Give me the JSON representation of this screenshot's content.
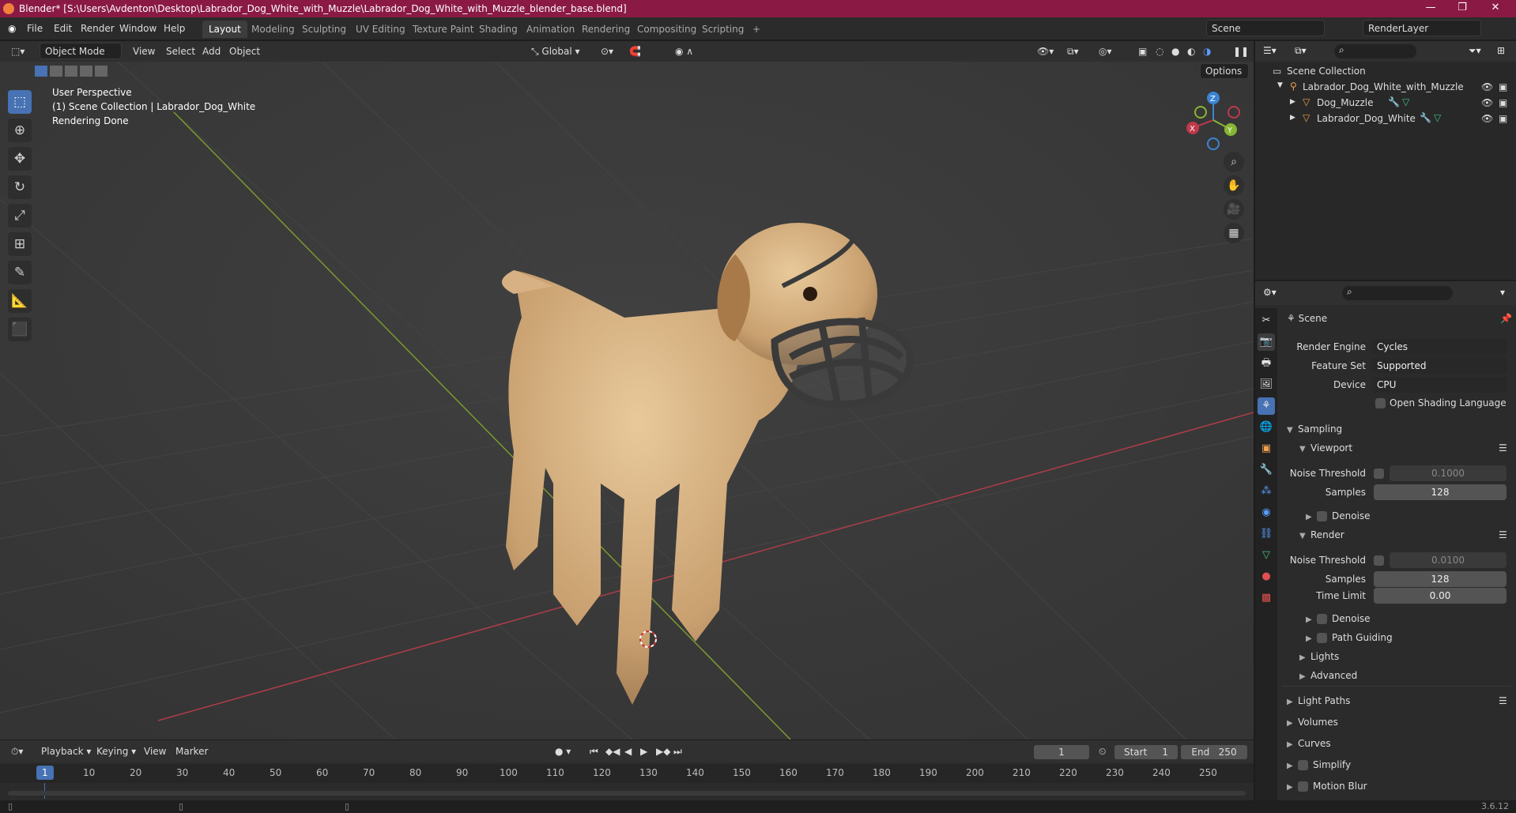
{
  "titlebar": {
    "title": "Blender* [S:\\Users\\Avdenton\\Desktop\\Labrador_Dog_White_with_Muzzle\\Labrador_Dog_White_with_Muzzle_blender_base.blend]",
    "minimize": "—",
    "restore": "❐",
    "close": "✕"
  },
  "menu": {
    "file": "File",
    "edit": "Edit",
    "render": "Render",
    "window": "Window",
    "help": "Help"
  },
  "workspaces": [
    "Layout",
    "Modeling",
    "Sculpting",
    "UV Editing",
    "Texture Paint",
    "Shading",
    "Animation",
    "Rendering",
    "Compositing",
    "Scripting",
    "+"
  ],
  "scene": {
    "name": "Scene",
    "render_layer": "RenderLayer"
  },
  "viewport_header": {
    "mode": "Object Mode",
    "view": "View",
    "select": "Select",
    "add": "Add",
    "object": "Object",
    "transform": "Global",
    "options": "Options"
  },
  "viewport": {
    "line1": "User Perspective",
    "line2": "(1) Scene Collection | Labrador_Dog_White",
    "line3": "Rendering Done"
  },
  "gizmo": {
    "z": "Z",
    "x": "X",
    "y": "Y"
  },
  "outliner": {
    "root": "Scene Collection",
    "collection": "Labrador_Dog_White_with_Muzzle",
    "obj1": "Dog_Muzzle",
    "obj2": "Labrador_Dog_White"
  },
  "properties": {
    "header": "Scene",
    "render_engine_label": "Render Engine",
    "render_engine": "Cycles",
    "feature_set_label": "Feature Set",
    "feature_set": "Supported",
    "device_label": "Device",
    "device": "CPU",
    "osl": "Open Shading Language",
    "sampling": "Sampling",
    "viewport": "Viewport",
    "noise_threshold_label": "Noise Threshold",
    "vp_noise": "0.1000",
    "samples_label": "Samples",
    "vp_samples": "128",
    "denoise": "Denoise",
    "render": "Render",
    "r_noise": "0.0100",
    "r_samples": "128",
    "time_limit_label": "Time Limit",
    "time_limit": "0.00",
    "path_guiding": "Path Guiding",
    "lights": "Lights",
    "advanced": "Advanced",
    "light_paths": "Light Paths",
    "volumes": "Volumes",
    "curves": "Curves",
    "simplify": "Simplify",
    "motion_blur": "Motion Blur"
  },
  "timeline": {
    "playback": "Playback",
    "keying": "Keying",
    "view": "View",
    "marker": "Marker",
    "current": "1",
    "start_label": "Start",
    "start": "1",
    "end_label": "End",
    "end": "250",
    "ticks": [
      "1",
      "10",
      "20",
      "30",
      "40",
      "50",
      "60",
      "70",
      "80",
      "90",
      "100",
      "110",
      "120",
      "130",
      "140",
      "150",
      "160",
      "170",
      "180",
      "190",
      "200",
      "210",
      "220",
      "230",
      "240",
      "250"
    ]
  },
  "status": {
    "version": "3.6.12"
  },
  "colors": {
    "title": "#8a1a44",
    "accent": "#4772b3",
    "x_axis": "#c0394b",
    "y_axis": "#86b633",
    "z_axis": "#3b84d4"
  }
}
